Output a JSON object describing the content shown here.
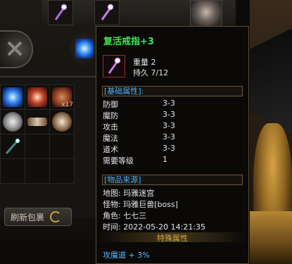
{
  "tooltip": {
    "title": "复活戒指+3",
    "weight_line": "重量 2",
    "durability_line": "持久 7/12",
    "base_section": "[基础属性]:",
    "attributes": [
      {
        "name": "防御",
        "value": "3-3"
      },
      {
        "name": "魔防",
        "value": "3-3"
      },
      {
        "name": "攻击",
        "value": "3-3"
      },
      {
        "name": "魔法",
        "value": "3-3"
      },
      {
        "name": "道术",
        "value": "3-3"
      },
      {
        "name": "需要等级",
        "value": "1"
      }
    ],
    "source_section": "[物品来源]",
    "source_lines": [
      "地图: 玛雅迷宫",
      "怪物: 玛雅巨兽[boss]",
      "角色: 七七三",
      "时间: 2022-05-20 14:21:35"
    ],
    "special_header": "特殊属性",
    "special_line": "攻魔道 + 3%"
  },
  "inventory": {
    "stack_count": "x17",
    "refresh_label": "刷新包裹"
  },
  "colors": {
    "title": "#3fe84f",
    "section": "#4db0ff",
    "special_header": "#d9a640",
    "special_line": "#58b9ff"
  },
  "icons": [
    "wand-icon",
    "blue-crystal-icon",
    "refresh-icon",
    "ring-icon"
  ]
}
